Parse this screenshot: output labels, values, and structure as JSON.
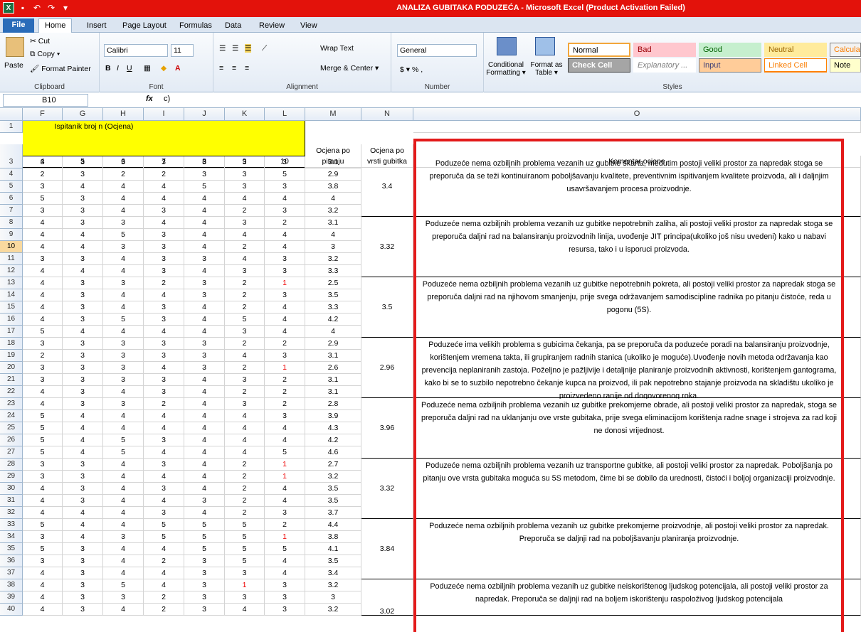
{
  "window": {
    "title": "ANALIZA GUBITAKA PODUZEĆA  -  Microsoft Excel (Product Activation Failed)"
  },
  "tabs": [
    "File",
    "Home",
    "Insert",
    "Page Layout",
    "Formulas",
    "Data",
    "Review",
    "View"
  ],
  "ribbon": {
    "clipboard": {
      "paste": "Paste",
      "cut": "Cut",
      "copy": "Copy ▾",
      "format_painter": "Format Painter",
      "label": "Clipboard"
    },
    "font": {
      "name": "Calibri",
      "size": "11",
      "label": "Font"
    },
    "alignment": {
      "wrap": "Wrap Text",
      "merge": "Merge & Center ▾",
      "label": "Alignment"
    },
    "number": {
      "format": "General",
      "currency": "$ ▾ %  ,",
      "label": "Number"
    },
    "styles": {
      "cond": "Conditional Formatting ▾",
      "table": "Format as Table ▾",
      "label": "Styles",
      "items": [
        {
          "name": "Normal",
          "bg": "#ffffff",
          "fg": "#000000",
          "border": "#f2a63b"
        },
        {
          "name": "Bad",
          "bg": "#ffc7ce",
          "fg": "#9c0006",
          "border": "#ffc7ce"
        },
        {
          "name": "Good",
          "bg": "#c6efce",
          "fg": "#006100",
          "border": "#c6efce"
        },
        {
          "name": "Neutral",
          "bg": "#ffeb9c",
          "fg": "#9c6500",
          "border": "#ffeb9c"
        },
        {
          "name": "Calcula",
          "bg": "#f2f2f2",
          "fg": "#fa7d00",
          "border": "#7f7f7f"
        },
        {
          "name": "Check Cell",
          "bg": "#a5a5a5",
          "fg": "#ffffff",
          "border": "#3f3f3f"
        },
        {
          "name": "Explanatory ...",
          "bg": "#ffffff",
          "fg": "#7f7f7f",
          "border": "#ffffff"
        },
        {
          "name": "Input",
          "bg": "#ffcc99",
          "fg": "#3f3f76",
          "border": "#7f7f7f"
        },
        {
          "name": "Linked Cell",
          "bg": "#ffffff",
          "fg": "#fa7d00",
          "border": "#ff8001"
        },
        {
          "name": "Note",
          "bg": "#ffffcc",
          "fg": "#000000",
          "border": "#b2b2b2"
        }
      ]
    }
  },
  "formula_bar": {
    "name_box": "B10",
    "fx": "fx",
    "value": "c)"
  },
  "columns": [
    "F",
    "G",
    "H",
    "I",
    "J",
    "K",
    "L",
    "M",
    "N",
    "O"
  ],
  "header": {
    "respondent": "Ispitanik broj n (Ocjena)",
    "nums": [
      "4",
      "5",
      "6",
      "7",
      "8",
      "9",
      "10"
    ],
    "m2a": "Ocjena po",
    "m2b": "pitanju",
    "n2a": "Ocjena po",
    "n2b": "vrsti gubitka",
    "o2": "Komentar ocjene"
  },
  "rows": [
    [
      "3",
      "3",
      "3",
      "3",
      "3",
      "3",
      "3",
      "3.1"
    ],
    [
      "2",
      "3",
      "2",
      "2",
      "3",
      "3",
      "5",
      "2.9"
    ],
    [
      "3",
      "4",
      "4",
      "4",
      "5",
      "3",
      "3",
      "3.8"
    ],
    [
      "5",
      "3",
      "4",
      "4",
      "4",
      "4",
      "4",
      "4"
    ],
    [
      "3",
      "3",
      "4",
      "3",
      "4",
      "2",
      "3",
      "3.2"
    ],
    [
      "4",
      "3",
      "3",
      "4",
      "4",
      "3",
      "2",
      "3.1"
    ],
    [
      "4",
      "4",
      "5",
      "3",
      "4",
      "4",
      "4",
      "4"
    ],
    [
      "4",
      "4",
      "3",
      "3",
      "4",
      "2",
      "4",
      "3"
    ],
    [
      "3",
      "3",
      "4",
      "3",
      "3",
      "4",
      "3",
      "3.2"
    ],
    [
      "4",
      "4",
      "4",
      "3",
      "4",
      "3",
      "3",
      "3.3"
    ],
    [
      "4",
      "3",
      "3",
      "2",
      "3",
      "2",
      "1",
      "2.5"
    ],
    [
      "4",
      "3",
      "4",
      "4",
      "3",
      "2",
      "3",
      "3.5"
    ],
    [
      "4",
      "3",
      "4",
      "3",
      "4",
      "2",
      "4",
      "3.3"
    ],
    [
      "4",
      "3",
      "5",
      "3",
      "4",
      "5",
      "4",
      "4.2"
    ],
    [
      "5",
      "4",
      "4",
      "4",
      "4",
      "3",
      "4",
      "4"
    ],
    [
      "3",
      "3",
      "3",
      "3",
      "3",
      "2",
      "2",
      "2.9"
    ],
    [
      "2",
      "3",
      "3",
      "3",
      "3",
      "4",
      "3",
      "3.1"
    ],
    [
      "3",
      "3",
      "3",
      "4",
      "3",
      "2",
      "1",
      "2.6"
    ],
    [
      "3",
      "3",
      "3",
      "3",
      "4",
      "3",
      "2",
      "3.1"
    ],
    [
      "4",
      "3",
      "4",
      "3",
      "4",
      "2",
      "2",
      "3.1"
    ],
    [
      "4",
      "3",
      "3",
      "2",
      "4",
      "3",
      "2",
      "2.8"
    ],
    [
      "5",
      "4",
      "4",
      "4",
      "4",
      "4",
      "3",
      "3.9"
    ],
    [
      "5",
      "4",
      "4",
      "4",
      "4",
      "4",
      "4",
      "4.3"
    ],
    [
      "5",
      "4",
      "5",
      "3",
      "4",
      "4",
      "4",
      "4.2"
    ],
    [
      "5",
      "4",
      "5",
      "4",
      "4",
      "4",
      "5",
      "4.6"
    ],
    [
      "3",
      "3",
      "4",
      "3",
      "4",
      "2",
      "1",
      "2.7"
    ],
    [
      "3",
      "3",
      "4",
      "4",
      "4",
      "2",
      "1",
      "3.2"
    ],
    [
      "4",
      "3",
      "4",
      "3",
      "4",
      "2",
      "4",
      "3.5"
    ],
    [
      "4",
      "3",
      "4",
      "4",
      "3",
      "2",
      "4",
      "3.5"
    ],
    [
      "4",
      "4",
      "4",
      "3",
      "4",
      "2",
      "3",
      "3.7"
    ],
    [
      "5",
      "4",
      "4",
      "5",
      "5",
      "5",
      "2",
      "4.4"
    ],
    [
      "3",
      "4",
      "3",
      "5",
      "5",
      "5",
      "1",
      "3.8"
    ],
    [
      "5",
      "3",
      "4",
      "4",
      "5",
      "5",
      "5",
      "4.1"
    ],
    [
      "3",
      "3",
      "4",
      "2",
      "3",
      "5",
      "4",
      "3.5"
    ],
    [
      "4",
      "3",
      "4",
      "4",
      "3",
      "3",
      "4",
      "3.4"
    ],
    [
      "4",
      "3",
      "5",
      "4",
      "3",
      "1",
      "3",
      "3.2"
    ],
    [
      "4",
      "3",
      "3",
      "2",
      "3",
      "3",
      "3",
      "3"
    ],
    [
      "4",
      "3",
      "4",
      "2",
      "3",
      "4",
      "3",
      "3.2"
    ]
  ],
  "red_cells": [
    [
      13,
      6
    ],
    [
      20,
      6
    ],
    [
      28,
      6
    ],
    [
      29,
      6
    ],
    [
      34,
      6
    ],
    [
      38,
      5
    ]
  ],
  "groups": [
    {
      "start": 3,
      "end": 7,
      "score": "3.4",
      "comment": "Poduzeće nema ozbiljnih problema vezanih uz gubitke škarta, međutim postoji veliki prostor za napredak stoga se preporuča da se teži kontinuiranom poboljšavanju kvalitete, preventivnim ispitivanjem kvalitete proizvoda, ali i daljnjim usavršavanjem procesa proizvodnje."
    },
    {
      "start": 8,
      "end": 12,
      "score": "3.32",
      "comment": "Poduzeće nema ozbiljnih problema vezanih uz gubitke nepotrebnih zaliha, ali postoji veliki prostor za napredak stoga se preporuča daljni rad na balansiranju proizvodnih linija, uvođenje JIT principa(ukoliko još nisu uvedeni) kako u nabavi resursa, tako i u isporuci proizvoda."
    },
    {
      "start": 13,
      "end": 17,
      "score": "3.5",
      "comment": "Poduzeće nema ozbiljnih problema vezanih uz gubitke nepotrebnih pokreta, ali postoji veliki prostor za napredak stoga se preporuča daljni rad na njihovom smanjenju, prije svega održavanjem samodiscipline radnika po pitanju čistoće, reda u pogonu (5S)."
    },
    {
      "start": 18,
      "end": 22,
      "score": "2.96",
      "comment": "Poduzeće ima velikih problema s gubicima čekanja, pa se preporuča da poduzeće poradi na balansiranju proizvodnje, korištenjem vremena takta, ili grupiranjem radnih stanica (ukoliko je moguće).Uvođenje novih metoda održavanja kao prevencija neplaniranih zastoja. Poželjno je pažljivije i detaljnije planiranje proizvodnih aktivnosti, korištenjem gantograma, kako bi se to suzbilo nepotrebno čekanje kupca na proizvod, ili pak nepotrebno stajanje proizvoda na skladištu ukoliko je proizvedeno ranije od dogovorenog roka."
    },
    {
      "start": 23,
      "end": 27,
      "score": "3.96",
      "comment": "Poduzeće nema ozbiljnih problema vezanih uz gubitke prekomjerne obrade, ali postoji veliki prostor za napredak, stoga se preporuča daljni rad na uklanjanju ove vrste gubitaka, prije svega eliminacijom korištenja radne snage i strojeva za rad koji ne donosi vrijednost."
    },
    {
      "start": 28,
      "end": 32,
      "score": "3.32",
      "comment": "Poduzeće nema ozbiljnih problema vezanih uz transportne gubitke, ali postoji veliki prostor za napredak. Poboljšanja po pitanju ove vrsta gubitaka moguća su 5S metodom, čime bi se dobilo da urednosti, čistoći i boljoj organizaciji proizvodnje."
    },
    {
      "start": 33,
      "end": 37,
      "score": "3.84",
      "comment": "Poduzeće nema ozbiljnih problema vezanih uz gubitke prekomjerne proizvodnje, ali postoji veliki prostor za napredak. Preporuča se daljnji rad na poboljšavanju planiranja proizvodnje."
    },
    {
      "start": 38,
      "end": 40,
      "score": "3.02",
      "comment": "Poduzeće nema ozbiljnih problema vezanih uz gubitke neiskorištenog ljudskog potencijala, ali postoji veliki prostor za napredak. Preporuča se daljnji rad na boljem iskorištenju raspoloživog ljudskog potencijala"
    }
  ]
}
